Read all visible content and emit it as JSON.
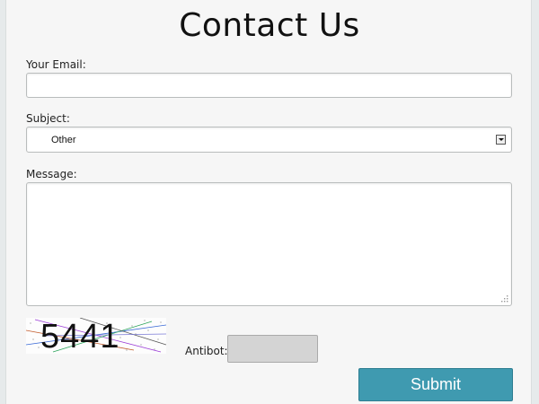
{
  "page": {
    "title": "Contact Us"
  },
  "form": {
    "email_label": "Your Email:",
    "email_value": "",
    "subject_label": "Subject:",
    "subject_value": "Other",
    "message_label": "Message:",
    "message_value": "",
    "captcha_text": "5441",
    "antibot_label": "Antibot:",
    "antibot_value": "",
    "submit_label": "Submit"
  },
  "colors": {
    "submit_bg": "#3f9ab0",
    "page_bg": "#f6f6f6",
    "antibot_bg": "#d4d4d4"
  },
  "icons": {
    "select_arrow": "chevron-down-icon",
    "resize_grip": "resize-grip-icon"
  }
}
